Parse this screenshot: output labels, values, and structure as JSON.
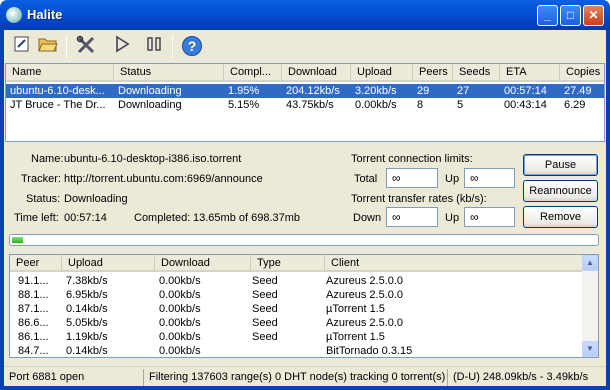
{
  "window": {
    "title": "Halite"
  },
  "torrent_table": {
    "columns": [
      "Name",
      "Status",
      "Compl...",
      "Download",
      "Upload",
      "Peers",
      "Seeds",
      "ETA",
      "Copies"
    ],
    "rows": [
      {
        "name": "ubuntu-6.10-desk...",
        "status": "Downloading",
        "completed": "1.95%",
        "download": "204.12kb/s",
        "upload": "3.20kb/s",
        "peers": "29",
        "seeds": "27",
        "eta": "00:57:14",
        "copies": "27.49"
      },
      {
        "name": "JT Bruce - The Dr...",
        "status": "Downloading",
        "completed": "5.15%",
        "download": "43.75kb/s",
        "upload": "0.00kb/s",
        "peers": "8",
        "seeds": "5",
        "eta": "00:43:14",
        "copies": "6.29"
      }
    ]
  },
  "details": {
    "name_label": "Name:",
    "name_value": "ubuntu-6.10-desktop-i386.iso.torrent",
    "tracker_label": "Tracker:",
    "tracker_value": "http://torrent.ubuntu.com:6969/announce",
    "status_label": "Status:",
    "status_value": "Downloading",
    "time_left_label": "Time left:",
    "time_left_value": "00:57:14",
    "completed_label": "Completed:",
    "completed_value": "13.65mb of 698.37mb",
    "progress_fraction": 0.0195
  },
  "limits": {
    "connection_title": "Torrent connection limits:",
    "transfer_title": "Torrent transfer rates (kb/s):",
    "total_label": "Total",
    "up_label": "Up",
    "down_label": "Down",
    "total_value": "∞",
    "up_conn_value": "∞",
    "down_rate_value": "∞",
    "up_rate_value": "∞"
  },
  "buttons": {
    "pause": "Pause",
    "reannounce": "Reannounce",
    "remove": "Remove"
  },
  "peers_table": {
    "columns": [
      "Peer",
      "Upload",
      "Download",
      "Type",
      "Client"
    ],
    "rows": [
      {
        "peer": "91.1...",
        "upload": "7.38kb/s",
        "download": "0.00kb/s",
        "type": "Seed",
        "client": "Azureus 2.5.0.0"
      },
      {
        "peer": "88.1...",
        "upload": "6.95kb/s",
        "download": "0.00kb/s",
        "type": "Seed",
        "client": "Azureus 2.5.0.0"
      },
      {
        "peer": "87.1...",
        "upload": "0.14kb/s",
        "download": "0.00kb/s",
        "type": "Seed",
        "client": "µTorrent 1.5"
      },
      {
        "peer": "86.6...",
        "upload": "5.05kb/s",
        "download": "0.00kb/s",
        "type": "Seed",
        "client": "Azureus 2.5.0.0"
      },
      {
        "peer": "86.1...",
        "upload": "1.19kb/s",
        "download": "0.00kb/s",
        "type": "Seed",
        "client": "µTorrent 1.5"
      },
      {
        "peer": "84.7...",
        "upload": "0.14kb/s",
        "download": "0.00kb/s",
        "type": "",
        "client": "BitTornado 0.3.15"
      }
    ]
  },
  "statusbar": {
    "port": "Port 6881 open",
    "filtering": "Filtering 137603 range(s) 0 DHT node(s) tracking 0 torrent(s)",
    "rates": "(D-U) 248.09kb/s - 3.49kb/s"
  },
  "icons": [
    "app-icon",
    "new-torrent-icon",
    "open-folder-icon",
    "settings-tools-icon",
    "resume-play-icon",
    "pause-icon",
    "help-icon"
  ],
  "colors": {
    "titlebar": "#0451d6",
    "selection": "#316ac5",
    "progress": "#2cb12c",
    "face": "#ece9d8"
  }
}
